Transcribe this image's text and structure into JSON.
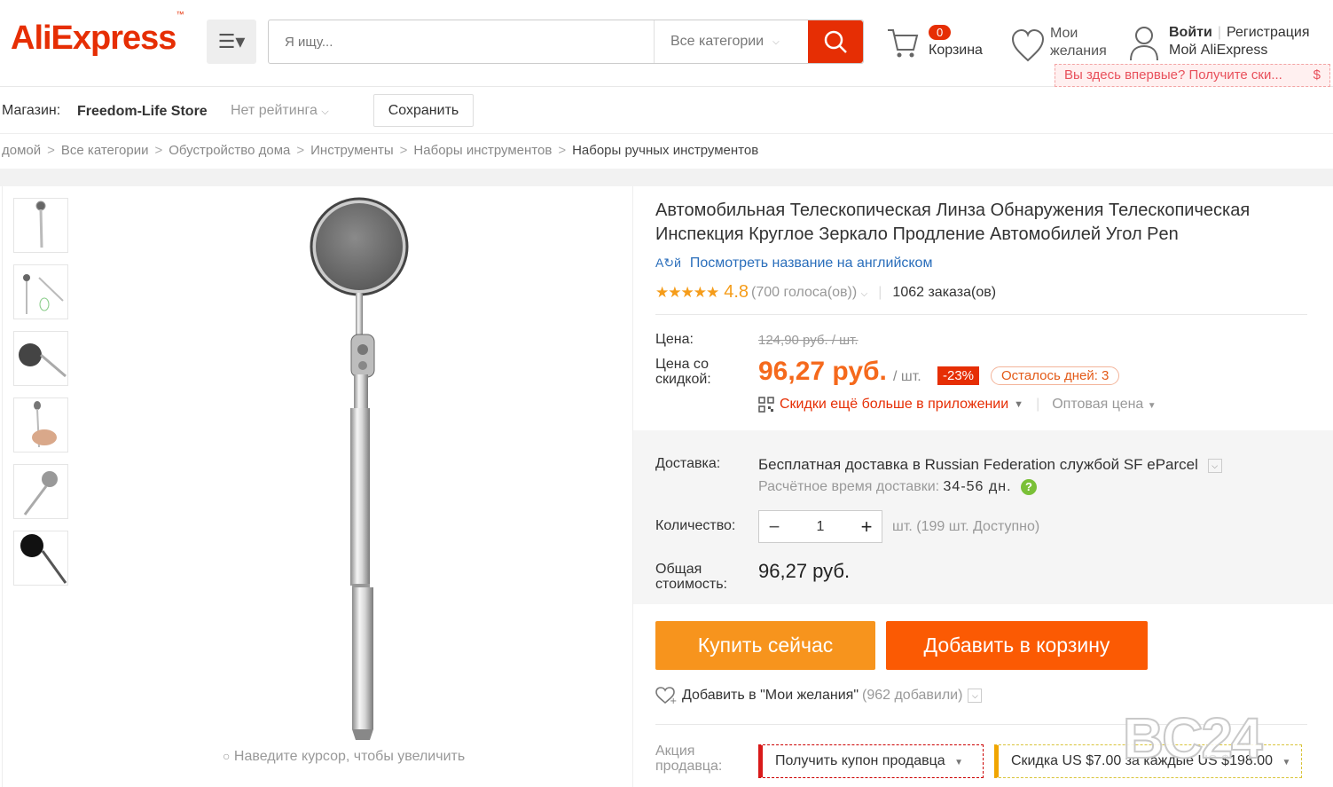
{
  "header": {
    "logo": "AliExpress",
    "logo_tm": "™",
    "search_placeholder": "Я ищу...",
    "category": "Все категории",
    "cart_count": "0",
    "cart_label": "Корзина",
    "wish_line1": "Мои",
    "wish_line2": "желания",
    "login": "Войти",
    "register": "Регистрация",
    "my_account": "Мой AliExpress",
    "promo_text": "Вы здесь впервые? Получите ски...",
    "promo_symbol": "$"
  },
  "store": {
    "label": "Магазин:",
    "name": "Freedom-Life Store",
    "rating": "Нет рейтинга",
    "save": "Сохранить"
  },
  "breadcrumb": [
    "домой",
    "Все категории",
    "Обустройство дома",
    "Инструменты",
    "Наборы инструментов",
    "Наборы ручных инструментов"
  ],
  "breadcrumb_sep": ">",
  "gallery": {
    "zoom_hint": "Наведите курсор, чтобы увеличить"
  },
  "product": {
    "title": "Автомобильная Телескопическая Линза Обнаружения Телескопическая Инспекция Круглое Зеркало Продление Автомобилей Угол Pen",
    "translate_link": "Посмотреть название на английском",
    "stars": "★★★★★",
    "rating": "4.8",
    "votes": "(700 голоса(ов))",
    "orders": "1062 заказа(ов)",
    "price_label": "Цена:",
    "old_price": "124,90 руб. / шт.",
    "sale_label": "Цена со скидкой:",
    "sale_price": "96,27 руб.",
    "per_unit": "/ шт.",
    "discount": "-23%",
    "days_left": "Осталось дней: 3",
    "app_discount": "Скидки ещё больше в приложении",
    "wholesale": "Оптовая цена",
    "shipping_label": "Доставка:",
    "shipping_free": "Бесплатная доставка в",
    "shipping_dest": "Russian Federation службой SF eParcel",
    "eta_label": "Расчётное время доставки:",
    "eta_days": "34-56 дн.",
    "qty_label": "Количество:",
    "qty_value": "1",
    "qty_avail": "шт. (199 шт. Доступно)",
    "total_label": "Общая стоимость:",
    "total_value": "96,27 руб.",
    "buy_now": "Купить сейчас",
    "add_to_cart": "Добавить в корзину",
    "add_wish": "Добавить в \"Мои желания\"",
    "wish_count": "(962 добавили)",
    "promo_label": "Акция продавца:",
    "coupon_seller": "Получить купон продавца",
    "coupon_discount": "Скидка US $7.00 за каждые US $198.00"
  },
  "watermark": "BC24",
  "colors": {
    "brand": "#e62e04",
    "buy": "#f7941d",
    "cart": "#fb5a03",
    "star": "#f59c1a"
  }
}
